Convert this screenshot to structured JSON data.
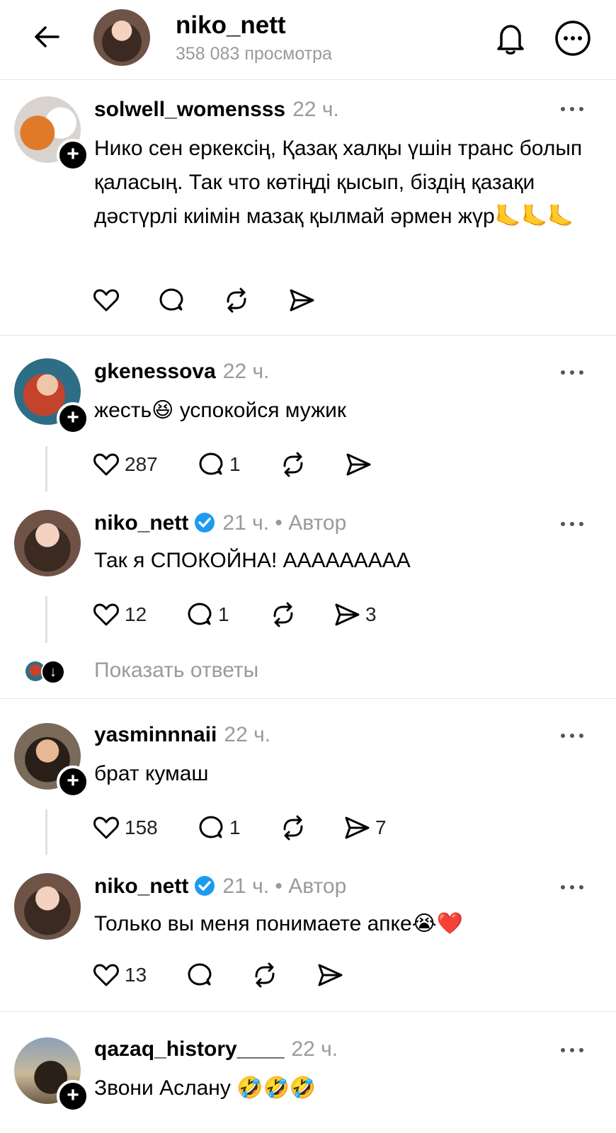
{
  "header": {
    "back_label": "←",
    "username": "niko_nett",
    "views": "358 083 просмотра"
  },
  "posts": [
    {
      "username": "solwell_womensss",
      "time": "22 ч.",
      "text": "Нико сен еркексің, Қазақ халқы үшін транс болып қаласың. Так что көтіңді қысып, біздің қазақи дәстүрлі киімін мазақ қылмай әрмен жүр🦶🦶🦶",
      "likes": "",
      "replies": "",
      "reposts": "",
      "shares": ""
    },
    {
      "username": "gkenessova",
      "time": "22 ч.",
      "text": "жесть😆 успокойся мужик",
      "likes": "287",
      "replies": "1",
      "reposts": "",
      "shares": ""
    },
    {
      "username": "niko_nett",
      "time": "21 ч. • Автор",
      "text": "Так я СПОКОЙНА! ААААААААА",
      "likes": "12",
      "replies": "1",
      "reposts": "",
      "shares": "3"
    },
    {
      "username": "yasminnnaii",
      "time": "22 ч.",
      "text": "брат кумаш",
      "likes": "158",
      "replies": "1",
      "reposts": "",
      "shares": "7"
    },
    {
      "username": "niko_nett",
      "time": "21 ч. • Автор",
      "text": "Только вы меня понимаете апке😭❤️",
      "likes": "13",
      "replies": "",
      "reposts": "",
      "shares": ""
    },
    {
      "username": "qazaq_history____",
      "time": "22 ч.",
      "text": "Звони Аслану 🤣🤣🤣",
      "likes": "",
      "replies": "",
      "reposts": "",
      "shares": ""
    }
  ],
  "show_replies_label": "Показать ответы",
  "colors": {
    "verified": "#1d9bf0",
    "muted": "#9a9a9a"
  },
  "icons": [
    "back-arrow-icon",
    "bell-icon",
    "more-icon",
    "heart-icon",
    "comment-icon",
    "repost-icon",
    "share-icon",
    "verified-icon",
    "plus-icon"
  ]
}
